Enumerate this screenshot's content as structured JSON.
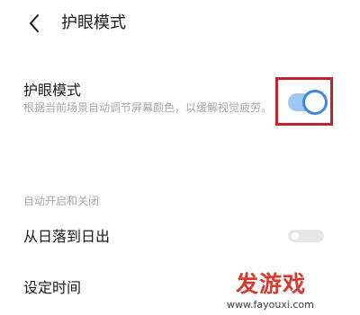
{
  "header": {
    "back_icon": "chevron-left-icon",
    "title": "护眼模式"
  },
  "eye_protection": {
    "title": "护眼模式",
    "description": "根据当前场景自动调节屏幕颜色，以缓解视觉疲劳。",
    "enabled": true,
    "toggle_color": "#3f87df",
    "highlight_color": "#c5212a"
  },
  "schedule": {
    "section_header": "自动开启和关闭",
    "sunset_label": "从日落到日出",
    "sunset_enabled": false,
    "time_label": "设定时间"
  },
  "watermark": {
    "logo": "发游戏",
    "url": "www.fayouxi.com"
  }
}
